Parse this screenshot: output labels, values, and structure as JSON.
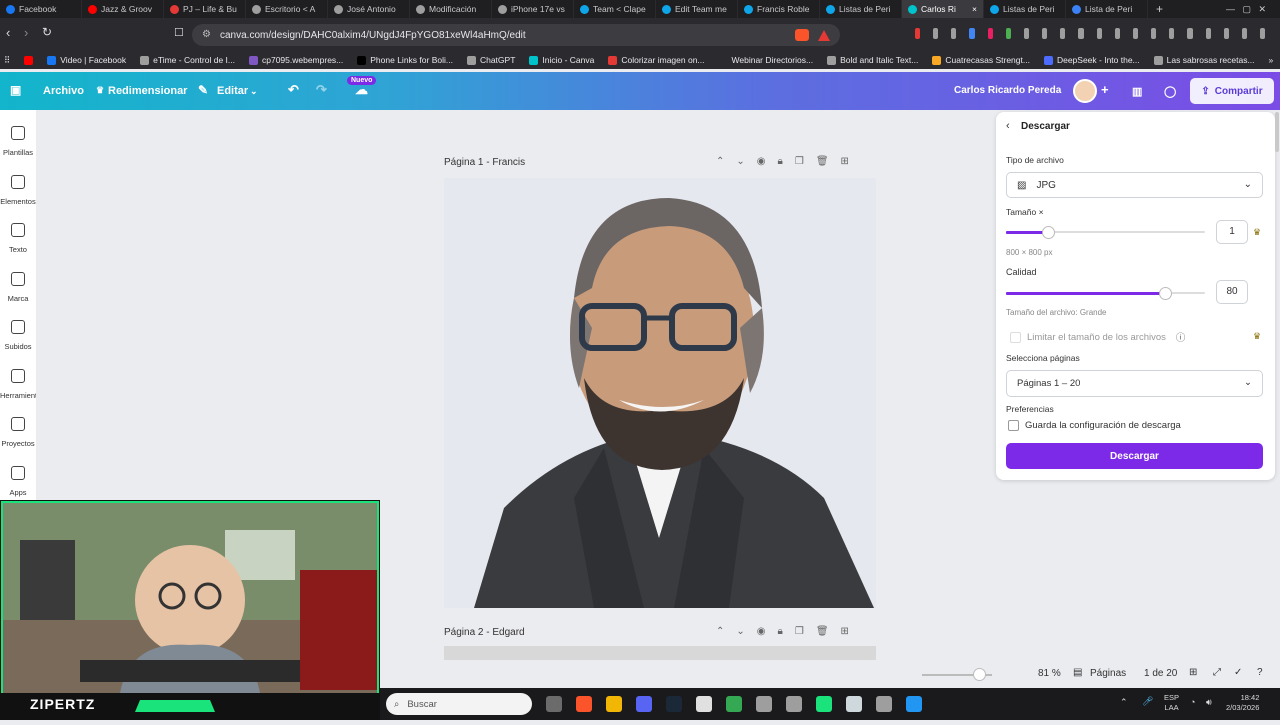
{
  "browser": {
    "tabs": [
      {
        "label": "Facebook",
        "color": "#1877f2"
      },
      {
        "label": "Jazz & Groov",
        "color": "#ff0000"
      },
      {
        "label": "PJ – Life & Bu",
        "color": "#e53935"
      },
      {
        "label": "Escritorio < A",
        "color": "#9e9e9e"
      },
      {
        "label": "José Antonio",
        "color": "#9e9e9e"
      },
      {
        "label": "Modificación",
        "color": "#9e9e9e"
      },
      {
        "label": "iPhone 17e vs",
        "color": "#9e9e9e"
      },
      {
        "label": "Team < Clape",
        "color": "#0ea5e9"
      },
      {
        "label": "Edit Team me",
        "color": "#0ea5e9"
      },
      {
        "label": "Francis Roble",
        "color": "#0ea5e9"
      },
      {
        "label": "Listas de Peri",
        "color": "#0ea5e9"
      },
      {
        "label": "Carlos Ri",
        "color": "#00c4cc",
        "active": true
      },
      {
        "label": "Listas de Peri",
        "color": "#0ea5e9"
      },
      {
        "label": "Lista de Peri",
        "color": "#3b82f6"
      }
    ],
    "url": "canva.com/design/DAHC0alxim4/UNgdJ4FpYGO81xeWl4aHmQ/edit",
    "bookmarks": [
      {
        "label": "Video | Facebook",
        "color": "#1877f2"
      },
      {
        "label": "eTime - Control de I...",
        "color": "#9e9e9e"
      },
      {
        "label": "cp7095.webempres...",
        "color": "#7e57c2"
      },
      {
        "label": "Phone Links for Boli...",
        "color": "#000000"
      },
      {
        "label": "ChatGPT",
        "color": "#9e9e9e"
      },
      {
        "label": "Inicio - Canva",
        "color": "#00c4cc"
      },
      {
        "label": "Colorizar imagen on...",
        "color": "#e53935"
      },
      {
        "label": "Webinar Directorios...",
        "color": "#2b2b2f"
      },
      {
        "label": "Bold and Italic Text...",
        "color": "#9e9e9e"
      },
      {
        "label": "Cuatrecasas Strengt...",
        "color": "#f9a825"
      },
      {
        "label": "DeepSeek - Into the...",
        "color": "#4d6bfe"
      },
      {
        "label": "Las sabrosas recetas...",
        "color": "#9e9e9e"
      }
    ]
  },
  "canva": {
    "menu": {
      "file": "Archivo",
      "resize": "Redimensionar",
      "edit": "Editar",
      "new_badge": "Nuevo"
    },
    "user_name": "Carlos Ricardo Pereda",
    "share": "Compartir",
    "sidebar": [
      "Plantillas",
      "Elementos",
      "Texto",
      "Marca",
      "Subidos",
      "Herramient...",
      "Proyectos",
      "Apps"
    ],
    "pages": [
      {
        "label": "Página 1 - Francis"
      },
      {
        "label": "Página 2 - Edgard"
      }
    ],
    "zoom": "81 %",
    "pages_btn": "Páginas",
    "page_count": "1 de 20",
    "download": {
      "title": "Descargar",
      "file_type_label": "Tipo de archivo",
      "file_type": "JPG",
      "size_label": "Tamaño ×",
      "size_value": "1",
      "size_level": 0.21,
      "dimensions": "800 × 800 px",
      "quality_label": "Calidad",
      "quality_value": "80",
      "quality_level": 0.8,
      "file_size": "Tamaño del archivo: Grande",
      "limit_label": "Limitar el tamaño de los archivos",
      "pages_label": "Selecciona páginas",
      "pages_value": "Páginas 1 – 20",
      "prefs_label": "Preferencias",
      "save_config": "Guarda la configuración de descarga",
      "button": "Descargar"
    }
  },
  "webcam": {
    "name": "ZIPERTZ"
  },
  "taskbar": {
    "search": "Buscar",
    "lang1": "ESP",
    "lang2": "LAA",
    "time": "18:42",
    "date": "2/03/2026"
  }
}
